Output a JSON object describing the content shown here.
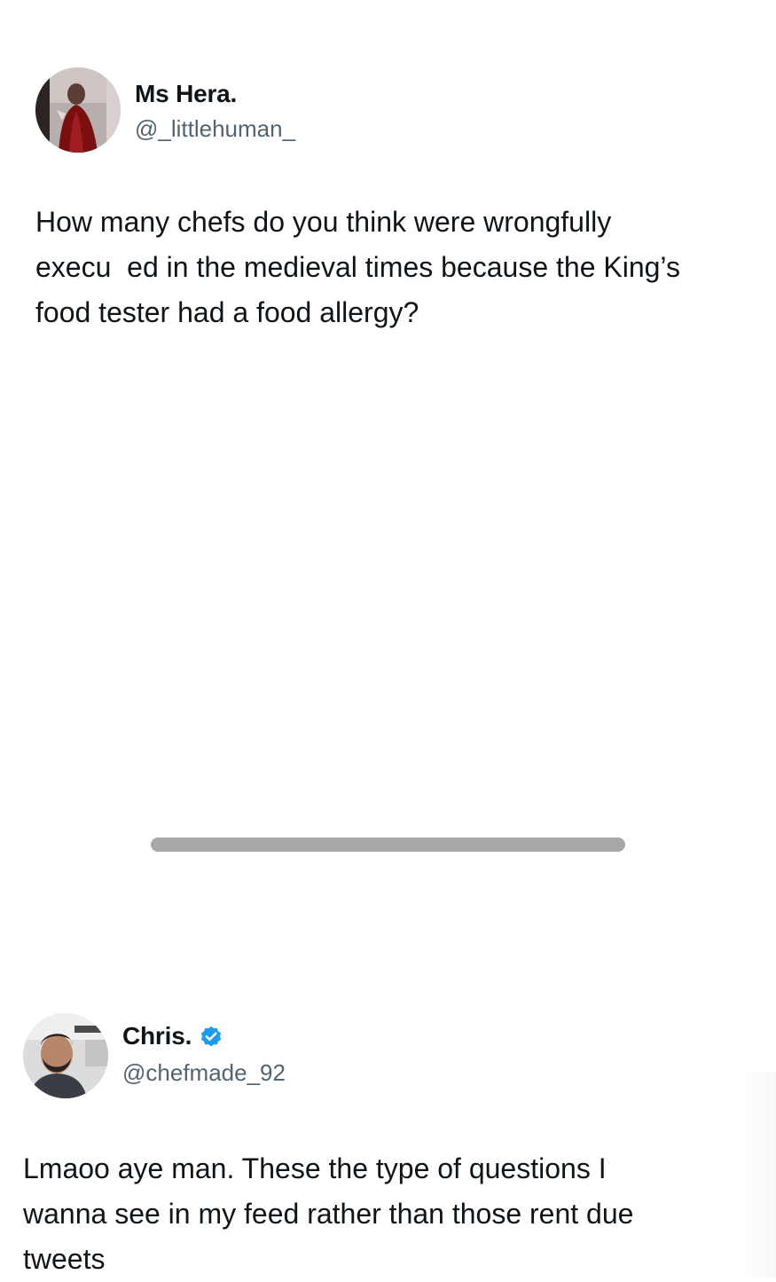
{
  "tweets": [
    {
      "display_name": "Ms Hera.",
      "handle": "@_littlehuman_",
      "verified": false,
      "avatar_icon": "profile-photo-dark-red-figure",
      "text": "How many chefs do you think were wrongfully\nexecu  ed in the medieval times because the King’s\nfood tester had a food allergy?"
    },
    {
      "display_name": "Chris.",
      "handle": "@chefmade_92",
      "verified": true,
      "verified_icon": "verified-badge-icon",
      "verified_color": "#1d9bf0",
      "avatar_icon": "profile-photo-man-beard",
      "text": "Lmaoo aye man. These the type of questions I\nwanna see in my feed rather than those rent due\ntweets"
    }
  ],
  "colors": {
    "background": "#ffffff",
    "text": "#0f1419",
    "handle": "#536471",
    "home_indicator": "#a8a8a8"
  }
}
